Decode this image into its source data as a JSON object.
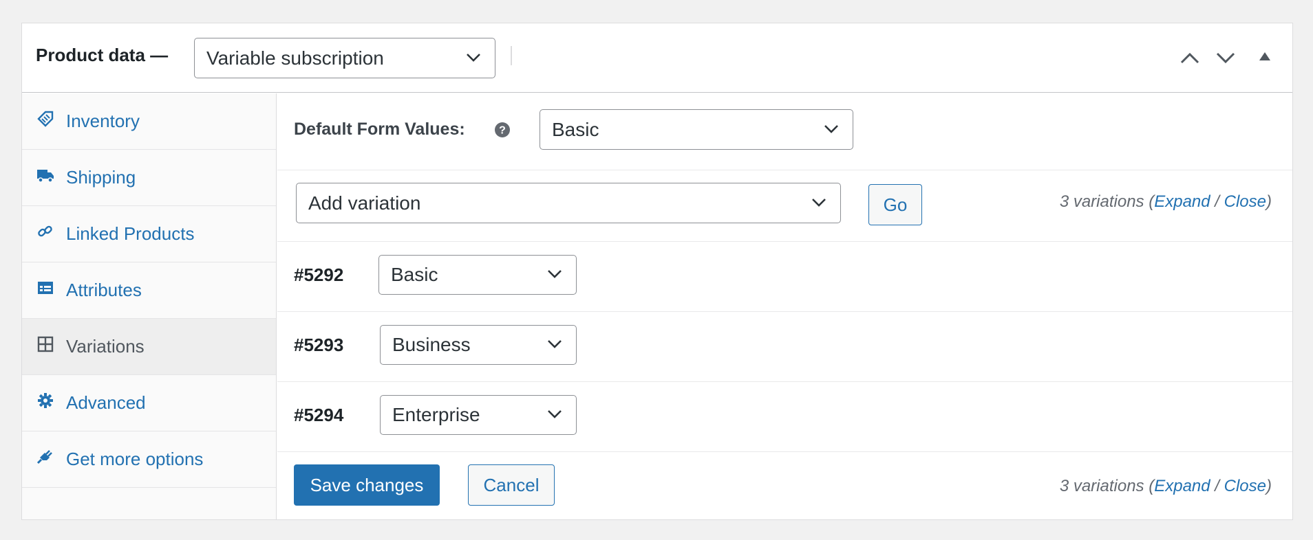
{
  "header": {
    "title": "Product data —",
    "product_type": "Variable subscription"
  },
  "sidebar": {
    "items": [
      {
        "label": "Inventory",
        "icon": "tag-icon"
      },
      {
        "label": "Shipping",
        "icon": "truck-icon"
      },
      {
        "label": "Linked Products",
        "icon": "link-icon"
      },
      {
        "label": "Attributes",
        "icon": "list-icon"
      },
      {
        "label": "Variations",
        "icon": "grid-icon",
        "active": true
      },
      {
        "label": "Advanced",
        "icon": "gear-icon"
      },
      {
        "label": "Get more options",
        "icon": "plugin-icon"
      }
    ]
  },
  "main": {
    "default_form_label": "Default Form Values:",
    "default_form_value": "Basic",
    "add_variation": "Add variation",
    "go_label": "Go",
    "count_text": "3 variations",
    "expand_label": "Expand",
    "close_label": "Close",
    "variations": [
      {
        "id": "#5292",
        "value": "Basic"
      },
      {
        "id": "#5293",
        "value": "Business"
      },
      {
        "id": "#5294",
        "value": "Enterprise"
      }
    ],
    "save_label": "Save changes",
    "cancel_label": "Cancel"
  },
  "colors": {
    "accent": "#2271b1",
    "active_tab_bg": "#eeeeee",
    "page_bg": "#f1f1f1"
  }
}
